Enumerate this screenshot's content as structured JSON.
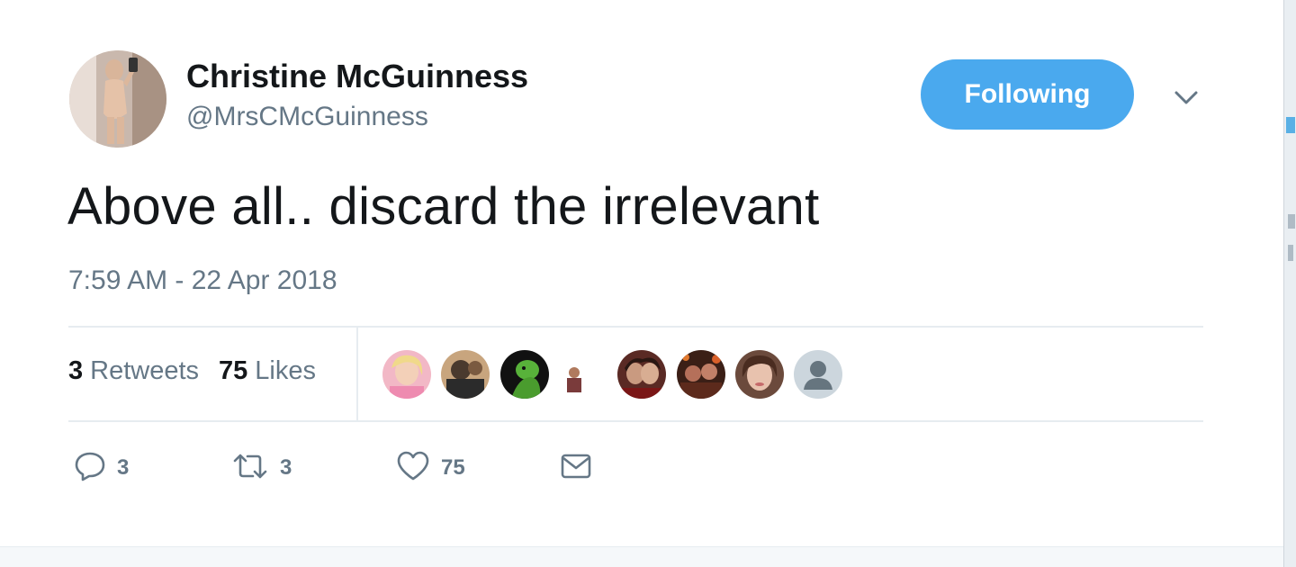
{
  "author": {
    "name": "Christine McGuinness",
    "handle": "@MrsCMcGuinness"
  },
  "follow_button": {
    "label": "Following"
  },
  "tweet": {
    "text": "Above all.. discard the irrelevant",
    "timestamp": "7:59 AM - 22 Apr 2018"
  },
  "stats": {
    "retweets_count": "3",
    "retweets_label": "Retweets",
    "likes_count": "75",
    "likes_label": "Likes"
  },
  "actions": {
    "reply_count": "3",
    "retweet_count": "3",
    "like_count": "75"
  },
  "icons": {
    "reply": "reply-icon",
    "retweet": "retweet-icon",
    "like": "heart-icon",
    "dm": "envelope-icon",
    "menu": "chevron-down-icon"
  },
  "colors": {
    "accent": "#4aa9ee",
    "secondary_text": "#657786",
    "primary_text": "#14171a"
  }
}
